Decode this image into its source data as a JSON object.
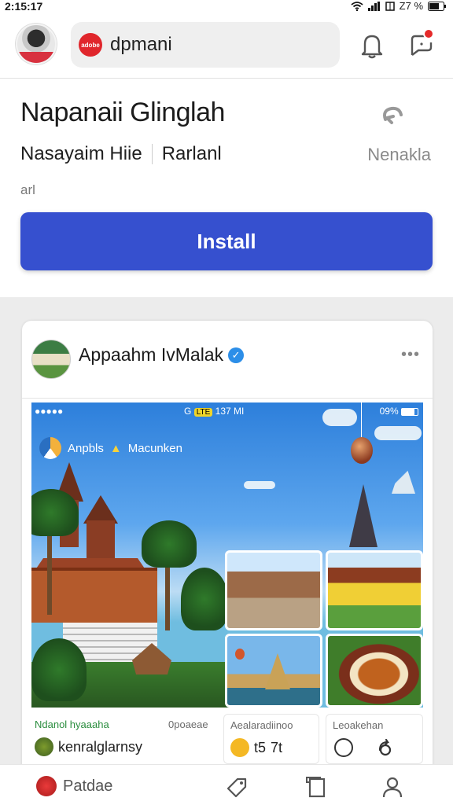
{
  "status_bar": {
    "time": "2:15:17",
    "battery_text": "Z7 %"
  },
  "top_bar": {
    "search_text": "dpmani",
    "search_logo_text": "adobe"
  },
  "app_info": {
    "title": "Napanaii Glinglah",
    "developer": "Nasayaim Hiie",
    "category": "Rarlanl",
    "right_meta": "Nenakla",
    "note": "arl",
    "install_label": "Install"
  },
  "post": {
    "author": "Appaahm IvMalak",
    "more_label": "•••",
    "screenshot": {
      "status_left": "●●●●●",
      "status_center_icon": "G",
      "status_badge": "LTE",
      "status_time": "137 MI",
      "status_right": "09%",
      "app_name": "Anpbls",
      "app_name_2": "Macunken"
    },
    "footer": {
      "col1_title": "Ndanol hyaaaha",
      "col1_sub": "0poaeae",
      "col1_user": "kenralglarnsy",
      "col2_title": "Aealaradiinoo",
      "col2_count1": "t5",
      "col2_count2": "7t",
      "col3_title": "Leoakehan"
    }
  },
  "bottom_nav": {
    "item1_label": "Patdae"
  },
  "colors": {
    "install_button": "#3650cf",
    "verified_badge": "#2c8ee8",
    "notification_dot": "#e52a2a"
  }
}
